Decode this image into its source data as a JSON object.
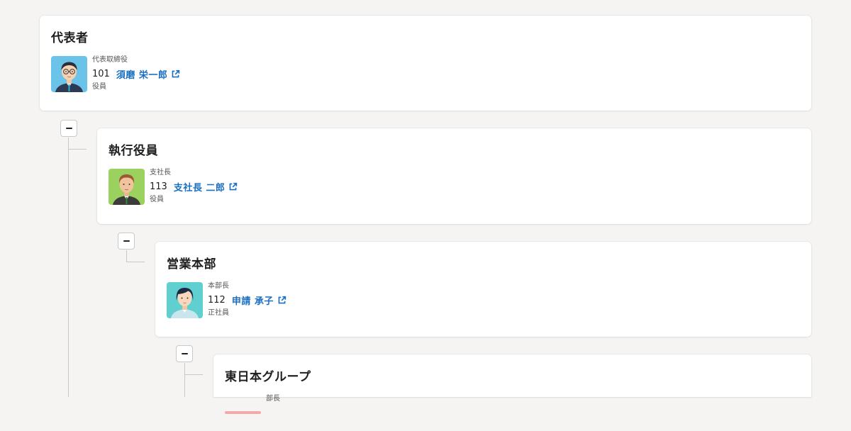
{
  "nodes": [
    {
      "title": "代表者",
      "person": {
        "role": "代表取締役",
        "emp_no": "101",
        "name": "須磨 栄一郎",
        "employment_type": "役員"
      }
    },
    {
      "title": "執行役員",
      "person": {
        "role": "支社長",
        "emp_no": "113",
        "name": "支社長 二郎",
        "employment_type": "役員"
      }
    },
    {
      "title": "営業本部",
      "person": {
        "role": "本部長",
        "emp_no": "112",
        "name": "申請 承子",
        "employment_type": "正社員"
      }
    },
    {
      "title": "東日本グループ",
      "person": {
        "role": "部長"
      }
    }
  ],
  "colors": {
    "link": "#1a6fc1",
    "background": "#f5f4f2",
    "card": "#ffffff"
  },
  "icons": {
    "external_link": "external-link-icon",
    "collapse": "minus-icon"
  }
}
